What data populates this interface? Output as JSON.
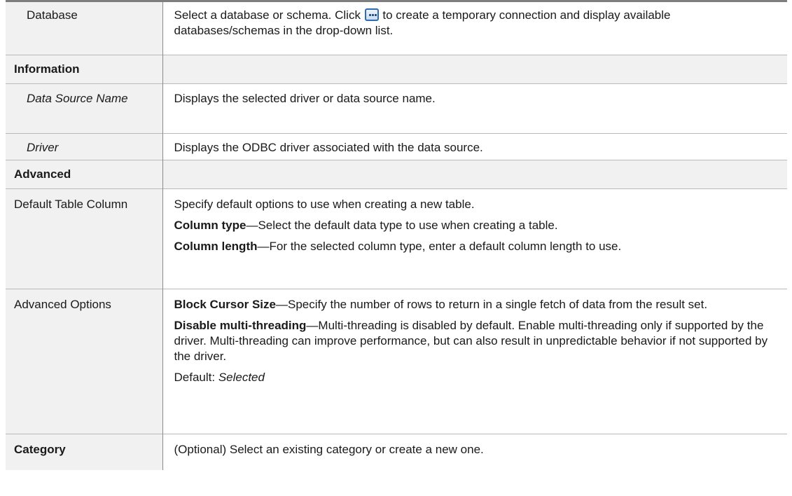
{
  "rows": {
    "database": {
      "label": "Database",
      "desc_before_icon": "Select a database or schema. Click ",
      "icon": "ellipsis-button-icon",
      "desc_after_icon": " to create a temporary connection and display available databases/schemas in the drop-down list."
    },
    "information": {
      "label": "Information"
    },
    "data_source_name": {
      "label": "Data Source Name",
      "desc": "Displays the selected driver or data source name."
    },
    "driver": {
      "label": "Driver",
      "desc": "Displays the ODBC driver associated with the data source."
    },
    "advanced": {
      "label": "Advanced"
    },
    "default_table_column": {
      "label": "Default Table Column",
      "intro": "Specify default options to use when creating a new table.",
      "column_type_term": "Column type",
      "column_type_text": "—Select the default data type to use when creating a table.",
      "column_length_term": "Column length",
      "column_length_text": "—For the selected column type, enter a default column length to use."
    },
    "advanced_options": {
      "label": "Advanced Options",
      "block_cursor_term": "Block Cursor Size",
      "block_cursor_text": "—Specify the number of rows to return in a single fetch of data from the result set.",
      "disable_mt_term": "Disable multi-threading",
      "disable_mt_text": "—Multi-threading is disabled by default. Enable multi-threading only if supported by the driver. Multi-threading can improve performance, but can also result in unpredictable behavior if not supported by the driver.",
      "default_prefix": "Default: ",
      "default_value": "Selected"
    },
    "category": {
      "label": "Category",
      "desc": "(Optional) Select an existing category or create a new one."
    }
  }
}
